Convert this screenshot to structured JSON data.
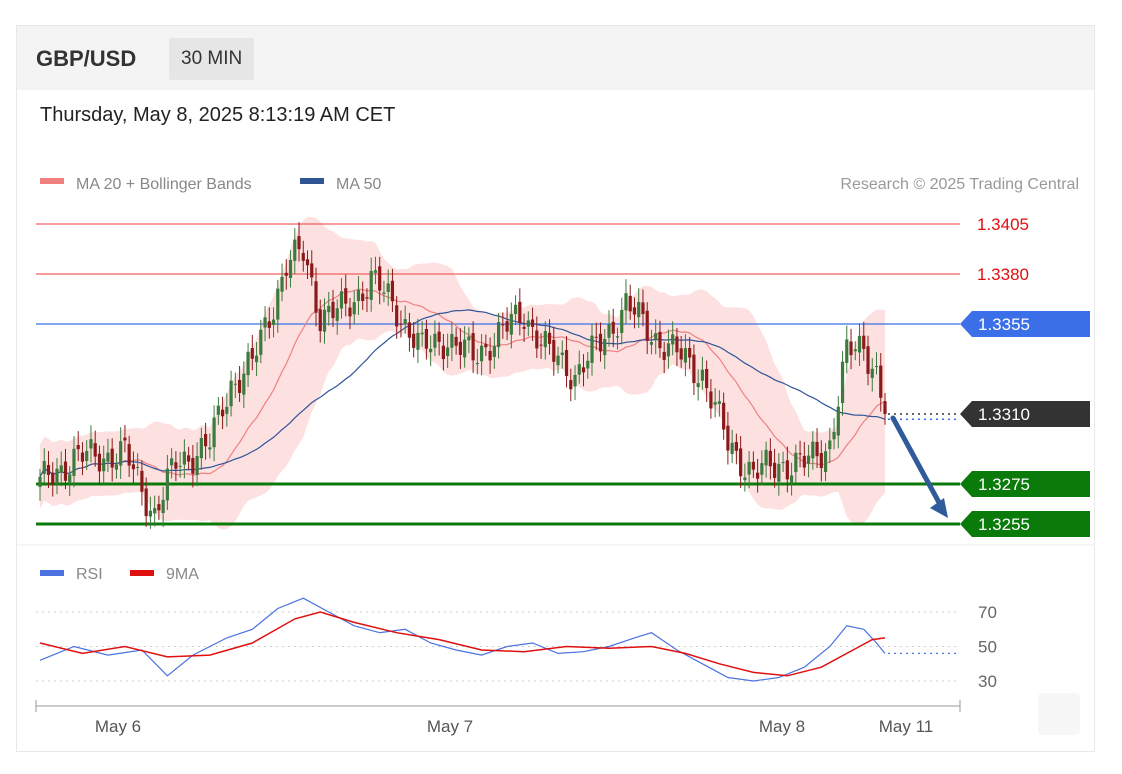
{
  "header": {
    "pair": "GBP/USD",
    "timeframe": "30 MIN",
    "datetime": "Thursday, May 8, 2025 8:13:19 AM CET"
  },
  "legend": {
    "ma20": "MA 20 + Bollinger Bands",
    "ma50": "MA 50",
    "credit": "Research © 2025 Trading Central",
    "ma20_color": "#f08080",
    "ma50_color": "#2f5597"
  },
  "rsi_legend": {
    "rsi": "RSI",
    "ma": "9MA",
    "rsi_color": "#4a72e0",
    "ma_color": "#e01010"
  },
  "colors": {
    "up": "#3d7a3d",
    "down": "#8b1a1a",
    "band": "#fde0e0",
    "resistance": "#f06060",
    "pivot": "#3b6fe8",
    "support": "#0a7a0a",
    "price_tag": "#333333",
    "arrow": "#2f5b9a"
  },
  "chart_data": [
    {
      "type": "candlestick",
      "title": "GBP/USD 30 MIN",
      "x_labels": [
        "May 6",
        "May 7",
        "May 8",
        "May 11"
      ],
      "ylim": [
        1.3245,
        1.3415
      ],
      "levels": [
        {
          "value": 1.3405,
          "label": "1.3405",
          "kind": "resistance"
        },
        {
          "value": 1.338,
          "label": "1.3380",
          "kind": "resistance"
        },
        {
          "value": 1.3355,
          "label": "1.3355",
          "kind": "pivot"
        },
        {
          "value": 1.331,
          "label": "1.3310",
          "kind": "price"
        },
        {
          "value": 1.3275,
          "label": "1.3275",
          "kind": "support"
        },
        {
          "value": 1.3255,
          "label": "1.3255",
          "kind": "support"
        }
      ],
      "key_closes": [
        {
          "x": 0,
          "close": 1.3275
        },
        {
          "x": 8,
          "close": 1.3288
        },
        {
          "x": 20,
          "close": 1.329
        },
        {
          "x": 27,
          "close": 1.326
        },
        {
          "x": 32,
          "close": 1.3285
        },
        {
          "x": 40,
          "close": 1.3295
        },
        {
          "x": 45,
          "close": 1.3325
        },
        {
          "x": 50,
          "close": 1.3335
        },
        {
          "x": 55,
          "close": 1.3365
        },
        {
          "x": 58,
          "close": 1.3385
        },
        {
          "x": 62,
          "close": 1.339
        },
        {
          "x": 66,
          "close": 1.336
        },
        {
          "x": 72,
          "close": 1.3362
        },
        {
          "x": 78,
          "close": 1.3378
        },
        {
          "x": 84,
          "close": 1.3362
        },
        {
          "x": 90,
          "close": 1.3342
        },
        {
          "x": 96,
          "close": 1.3348
        },
        {
          "x": 102,
          "close": 1.3338
        },
        {
          "x": 108,
          "close": 1.335
        },
        {
          "x": 114,
          "close": 1.336
        },
        {
          "x": 120,
          "close": 1.334
        },
        {
          "x": 126,
          "close": 1.333
        },
        {
          "x": 132,
          "close": 1.3345
        },
        {
          "x": 138,
          "close": 1.3365
        },
        {
          "x": 144,
          "close": 1.335
        },
        {
          "x": 150,
          "close": 1.334
        },
        {
          "x": 156,
          "close": 1.333
        },
        {
          "x": 162,
          "close": 1.3295
        },
        {
          "x": 168,
          "close": 1.328
        },
        {
          "x": 174,
          "close": 1.3285
        },
        {
          "x": 180,
          "close": 1.3285
        },
        {
          "x": 186,
          "close": 1.3295
        },
        {
          "x": 190,
          "close": 1.334
        },
        {
          "x": 194,
          "close": 1.3345
        },
        {
          "x": 197,
          "close": 1.333
        },
        {
          "x": 199,
          "close": 1.331
        }
      ],
      "forecast": {
        "from": 1.331,
        "to": 1.3255
      }
    },
    {
      "type": "line",
      "title": "RSI",
      "y_ticks": [
        30,
        50,
        70
      ],
      "ylim": [
        20,
        80
      ],
      "series": [
        {
          "name": "RSI",
          "points": [
            [
              0,
              42
            ],
            [
              8,
              50
            ],
            [
              16,
              45
            ],
            [
              24,
              48
            ],
            [
              30,
              33
            ],
            [
              36,
              45
            ],
            [
              44,
              55
            ],
            [
              50,
              60
            ],
            [
              56,
              72
            ],
            [
              62,
              78
            ],
            [
              68,
              70
            ],
            [
              74,
              62
            ],
            [
              80,
              58
            ],
            [
              86,
              60
            ],
            [
              92,
              52
            ],
            [
              98,
              48
            ],
            [
              104,
              45
            ],
            [
              110,
              50
            ],
            [
              116,
              52
            ],
            [
              122,
              46
            ],
            [
              128,
              47
            ],
            [
              134,
              50
            ],
            [
              140,
              55
            ],
            [
              144,
              58
            ],
            [
              150,
              48
            ],
            [
              156,
              40
            ],
            [
              162,
              32
            ],
            [
              168,
              30
            ],
            [
              174,
              32
            ],
            [
              180,
              38
            ],
            [
              186,
              50
            ],
            [
              190,
              62
            ],
            [
              194,
              60
            ],
            [
              197,
              52
            ],
            [
              199,
              46
            ]
          ]
        },
        {
          "name": "9MA",
          "points": [
            [
              0,
              52
            ],
            [
              10,
              46
            ],
            [
              20,
              50
            ],
            [
              30,
              44
            ],
            [
              40,
              45
            ],
            [
              50,
              52
            ],
            [
              60,
              66
            ],
            [
              66,
              70
            ],
            [
              74,
              64
            ],
            [
              84,
              58
            ],
            [
              94,
              54
            ],
            [
              104,
              48
            ],
            [
              114,
              47
            ],
            [
              124,
              50
            ],
            [
              134,
              49
            ],
            [
              144,
              50
            ],
            [
              152,
              46
            ],
            [
              160,
              40
            ],
            [
              168,
              35
            ],
            [
              176,
              33
            ],
            [
              184,
              38
            ],
            [
              190,
              46
            ],
            [
              196,
              54
            ],
            [
              199,
              55
            ]
          ]
        }
      ]
    }
  ]
}
